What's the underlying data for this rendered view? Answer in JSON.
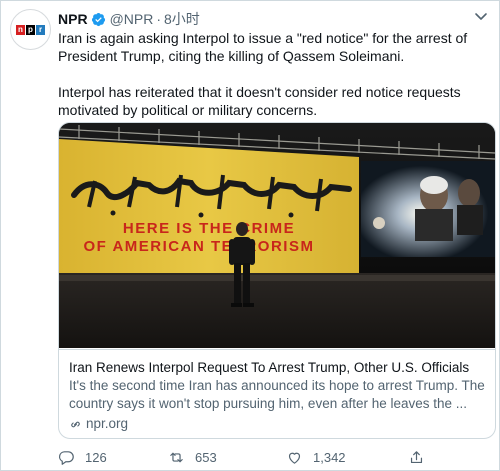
{
  "tweet": {
    "author_name": "NPR",
    "handle": "@NPR",
    "separator": "·",
    "time": "8小时",
    "avatar_logo": [
      "n",
      "p",
      "r"
    ],
    "paragraphs": [
      "Iran is again asking Interpol to issue a \"red notice\" for the arrest of President Trump, citing the killing of Qassem Soleimani.",
      "Interpol has reiterated that it doesn't consider red notice requests motivated by political or military concerns."
    ]
  },
  "card": {
    "image": {
      "banner_arabic": "هنا جريمة الأرهاب الأمريكي",
      "banner_line1": "HERE IS THE CRIME",
      "banner_line2": "OF AMERICAN TERRORISM"
    },
    "title": "Iran Renews Interpol Request To Arrest Trump, Other U.S. Officials",
    "description": "It's the second time Iran has announced its hope to arrest Trump. The country says it won't stop pursuing him, even after he leaves the ...",
    "domain": "npr.org"
  },
  "actions": {
    "replies": "126",
    "retweets": "653",
    "likes": "1,342"
  },
  "colors": {
    "verified": "#1d9bf0",
    "secondary_text": "#536471",
    "border": "#cfd9de",
    "banner_yellow": "#e3c23a",
    "banner_red": "#c8261b"
  },
  "icons": [
    "verified-badge-icon",
    "caret-down-icon",
    "link-icon",
    "reply-icon",
    "retweet-icon",
    "like-icon",
    "share-icon"
  ]
}
